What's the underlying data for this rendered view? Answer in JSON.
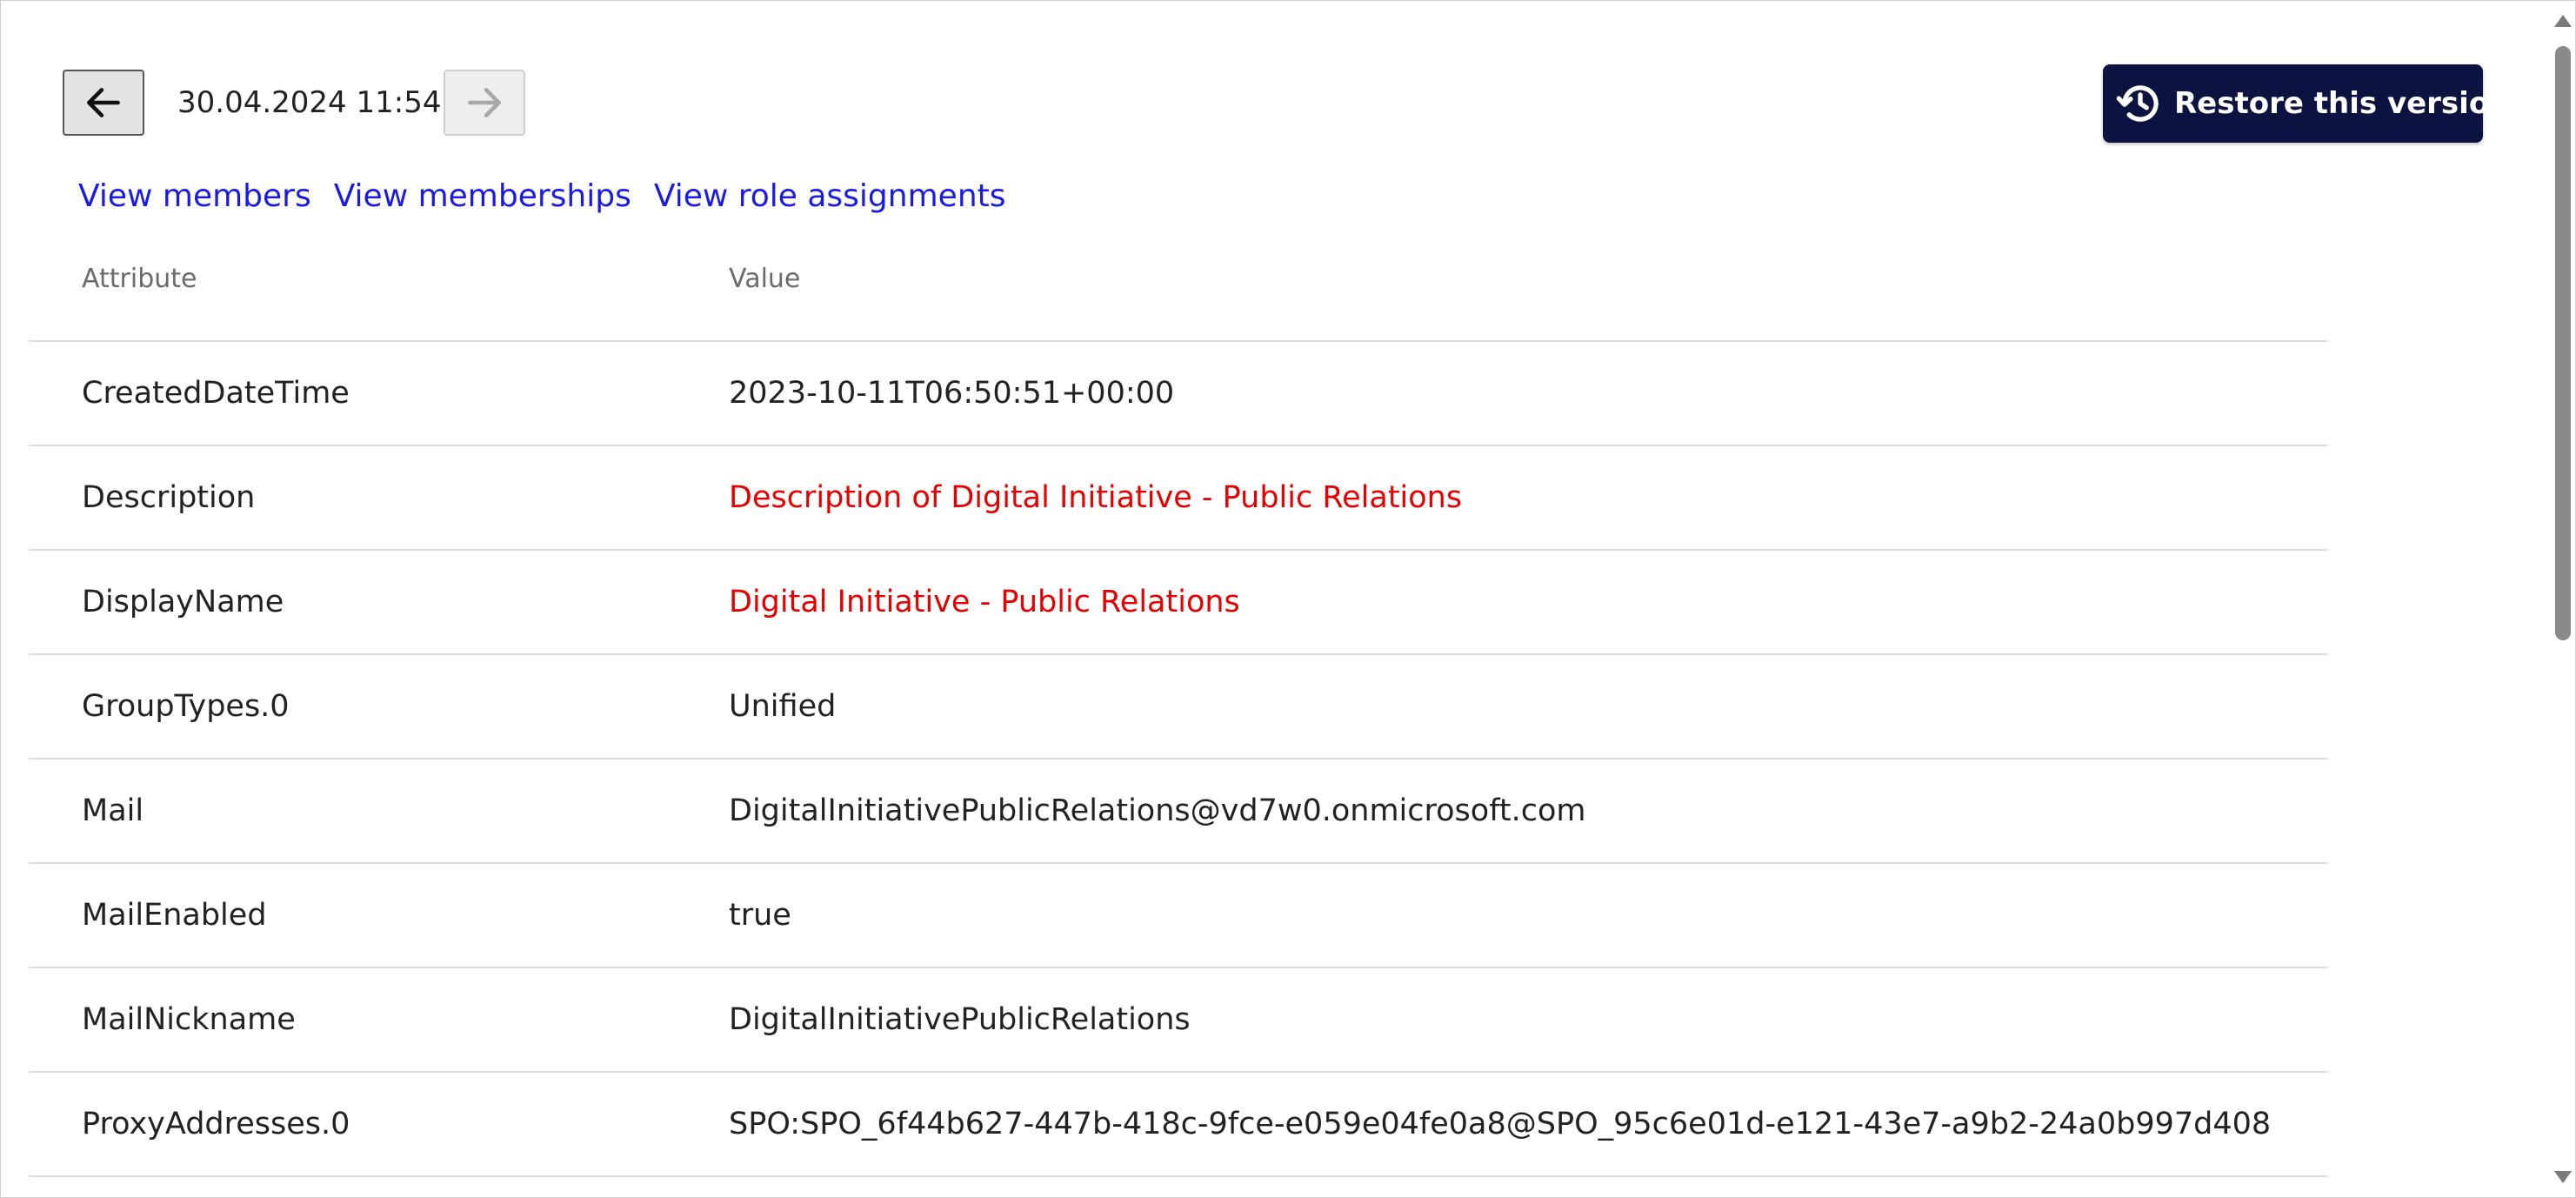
{
  "toolbar": {
    "version_date": "30.04.2024 11:54",
    "restore_label": "Restore this version",
    "prev_icon": "arrow-left-icon",
    "next_icon": "arrow-right-icon",
    "restore_icon": "history-icon"
  },
  "links": [
    {
      "label": "View members"
    },
    {
      "label": "View memberships"
    },
    {
      "label": "View role assignments"
    }
  ],
  "table": {
    "headers": {
      "attribute": "Attribute",
      "value": "Value"
    },
    "rows": [
      {
        "attribute": "CreatedDateTime",
        "value": "2023-10-11T06:50:51+00:00",
        "changed": false
      },
      {
        "attribute": "Description",
        "value": "Description of Digital Initiative - Public Relations",
        "changed": true
      },
      {
        "attribute": "DisplayName",
        "value": "Digital Initiative - Public Relations",
        "changed": true
      },
      {
        "attribute": "GroupTypes.0",
        "value": "Unified",
        "changed": false
      },
      {
        "attribute": "Mail",
        "value": "DigitalInitiativePublicRelations@vd7w0.onmicrosoft.com",
        "changed": false
      },
      {
        "attribute": "MailEnabled",
        "value": "true",
        "changed": false
      },
      {
        "attribute": "MailNickname",
        "value": "DigitalInitiativePublicRelations",
        "changed": false
      },
      {
        "attribute": "ProxyAddresses.0",
        "value": "SPO:SPO_6f44b627-447b-418c-9fce-e059e04fe0a8@SPO_95c6e01d-e121-43e7-a9b2-24a0b997d408",
        "changed": false
      }
    ]
  },
  "colors": {
    "changed_value": "#e60000",
    "link": "#1a1ae6",
    "restore_button_bg": "#0c1340"
  }
}
